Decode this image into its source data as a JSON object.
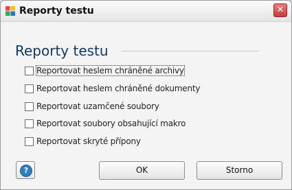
{
  "window": {
    "title": "Reporty testu"
  },
  "heading": "Reporty testu",
  "options": [
    {
      "label": "Reportovat heslem chráněné archivy",
      "checked": false
    },
    {
      "label": "Reportovat heslem chráněné dokumenty",
      "checked": false
    },
    {
      "label": "Reportovat uzamčené soubory",
      "checked": false
    },
    {
      "label": "Reportovat soubory obsahující makro",
      "checked": false
    },
    {
      "label": "Reportovat skryté přípony",
      "checked": false
    }
  ],
  "buttons": {
    "help_icon": "?",
    "ok": "OK",
    "cancel": "Storno",
    "close": "✕"
  },
  "icons": {
    "app": "avg-app-icon",
    "help": "help-icon",
    "close": "close-icon"
  },
  "colors": {
    "heading": "#0f3a66",
    "close": "#c63a3a",
    "help": "#2d7fc1"
  }
}
